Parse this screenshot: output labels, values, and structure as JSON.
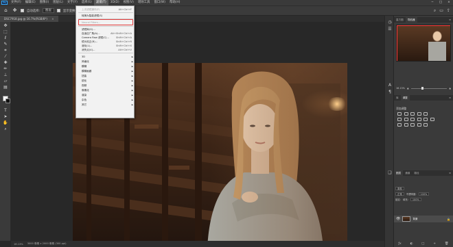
{
  "app": {
    "logo_text": "Ps"
  },
  "menubar": {
    "items": [
      "文件(F)",
      "编辑(E)",
      "图像(I)",
      "图层(L)",
      "文字(Y)",
      "选择(S)",
      "滤镜(T)",
      "3D(D)",
      "视图(V)",
      "增效工具",
      "窗口(W)",
      "帮助(H)"
    ],
    "active_index": 6,
    "window_controls": [
      "−",
      "□",
      "×"
    ]
  },
  "options": {
    "auto_select_label": "自动选择:",
    "layer_select": "图层",
    "show_transform_label": "显示变换控件",
    "mode_3d_label": "3D 模式:"
  },
  "document": {
    "tab_title": "DSC7918.jpg @ 16.7%(RGB/8*)",
    "close_glyph": "×"
  },
  "filter_menu": {
    "items": [
      {
        "label": "上次滤镜操作(F)",
        "shortcut": "Alt+Ctrl+F",
        "disabled": true,
        "submenu": false
      },
      {
        "label": "转换为智能滤镜(S)",
        "shortcut": "",
        "disabled": false,
        "submenu": false
      },
      {
        "label": "Neural Filters...",
        "shortcut": "",
        "disabled": true,
        "submenu": false
      },
      {
        "label": "滤镜库(G)...",
        "shortcut": "",
        "disabled": false,
        "submenu": false
      },
      {
        "label": "自适应广角(A)...",
        "shortcut": "Alt+Shift+Ctrl+A",
        "disabled": false,
        "submenu": false
      },
      {
        "label": "Camera Raw 滤镜(C)...",
        "shortcut": "Shift+Ctrl+A",
        "disabled": false,
        "submenu": false
      },
      {
        "label": "镜头校正(R)...",
        "shortcut": "Shift+Ctrl+R",
        "disabled": false,
        "submenu": false
      },
      {
        "label": "液化(L)...",
        "shortcut": "Shift+Ctrl+X",
        "disabled": false,
        "submenu": false
      },
      {
        "label": "消失点(V)...",
        "shortcut": "Alt+Ctrl+V",
        "disabled": false,
        "submenu": false
      },
      {
        "label": "3D",
        "shortcut": "",
        "disabled": false,
        "submenu": true
      },
      {
        "label": "风格化",
        "shortcut": "",
        "disabled": false,
        "submenu": true
      },
      {
        "label": "模糊",
        "shortcut": "",
        "disabled": false,
        "submenu": true
      },
      {
        "label": "模糊画廊",
        "shortcut": "",
        "disabled": false,
        "submenu": true
      },
      {
        "label": "扭曲",
        "shortcut": "",
        "disabled": false,
        "submenu": true
      },
      {
        "label": "锐化",
        "shortcut": "",
        "disabled": false,
        "submenu": true
      },
      {
        "label": "视频",
        "shortcut": "",
        "disabled": false,
        "submenu": true
      },
      {
        "label": "像素化",
        "shortcut": "",
        "disabled": false,
        "submenu": true
      },
      {
        "label": "渲染",
        "shortcut": "",
        "disabled": false,
        "submenu": true
      },
      {
        "label": "杂色",
        "shortcut": "",
        "disabled": false,
        "submenu": true
      },
      {
        "label": "其它",
        "shortcut": "",
        "disabled": false,
        "submenu": true
      }
    ],
    "highlighted_index": 2,
    "highlight_color": "#e03a3a",
    "submenu_arrow": "▶"
  },
  "panels": {
    "top_tabs": [
      "直方图",
      "导航器"
    ],
    "top_active": 1,
    "zoom_value": "16.13%",
    "adjust_tabs": [
      "库",
      "调整"
    ],
    "adjust_active": 1,
    "adjust_label": "添加调整",
    "layer_tabs": [
      "图层",
      "通道",
      "路径"
    ],
    "layer_active": 0,
    "layer_kind": "类型",
    "blend_mode": "正常",
    "opacity_label": "不透明度:",
    "opacity_value": "100%",
    "lock_label": "锁定:",
    "fill_label": "填充:",
    "fill_value": "100%",
    "layer_name": "背景",
    "panel_menu_glyph": "≡",
    "bottom_icons": [
      "ƒx",
      "◐",
      "□",
      "+",
      "🗑"
    ]
  },
  "status": {
    "zoom": "16.13%",
    "doc_info": "3000 像素 x 2000 像素 (300 ppi)"
  },
  "colors": {
    "accent": "#31a8ff",
    "menu_bg": "#f2f2f2",
    "ui_dark": "#3a3a3a",
    "canvas_bg": "#282828"
  }
}
